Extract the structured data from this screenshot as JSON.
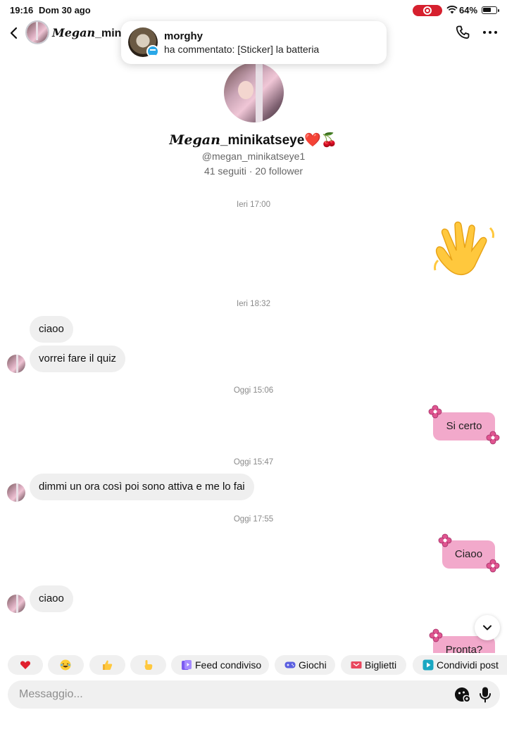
{
  "status_bar": {
    "time": "19:16",
    "date": "Dom 30 ago",
    "battery": "64%"
  },
  "header": {
    "name_styled": "Megan",
    "name_rest": "_minik"
  },
  "notification": {
    "title": "morghy",
    "text": "ha commentato: [Sticker] la batteria"
  },
  "profile": {
    "name_styled": "Megan",
    "name_rest": "_minikatseye❤️🍒",
    "handle": "@megan_minikatseye1",
    "stats": "41 seguiti · 20 follower"
  },
  "messages": {
    "ts1": "Ieri 17:00",
    "ts2": "Ieri 18:32",
    "in1": "ciaoo",
    "in2": "vorrei fare il quiz",
    "ts3": "Oggi 15:06",
    "out1": "Si certo",
    "ts4": "Oggi 15:47",
    "in3": "dimmi un ora così poi sono attiva e me lo fai",
    "ts5": "Oggi 17:55",
    "out2": "Ciaoo",
    "in4": "ciaoo",
    "out3": "Pronta?"
  },
  "quick_replies": {
    "feed": "Feed condiviso",
    "games": "Giochi",
    "tickets": "Biglietti",
    "share": "Condividi post"
  },
  "composer": {
    "placeholder": "Messaggio..."
  },
  "colors": {
    "accent_pink": "#f2a9cb",
    "bubble_gray": "#efefef",
    "rec_red": "#d6202e"
  }
}
